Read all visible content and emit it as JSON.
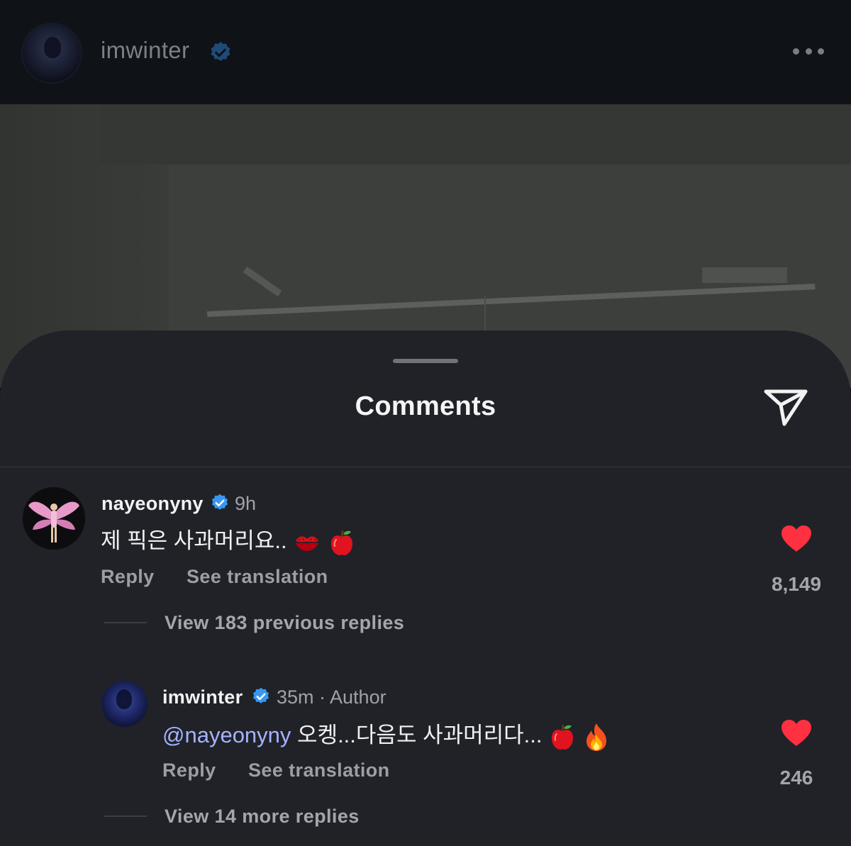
{
  "post": {
    "username": "imwinter"
  },
  "sheet": {
    "title": "Comments"
  },
  "comments": [
    {
      "username": "nayeonyny",
      "time": "9h",
      "text": "제 픽은 사과머리요..",
      "emojis": [
        "kiss-mark",
        "red-apple"
      ],
      "reply_label": "Reply",
      "translate_label": "See translation",
      "likes": "8,149",
      "view_replies": "View 183 previous replies"
    },
    {
      "username": "imwinter",
      "time": "35m · Author",
      "mention": "@nayeonyny",
      "text": " 오켕...다음도 사과머리다...",
      "emojis": [
        "red-apple",
        "fire"
      ],
      "reply_label": "Reply",
      "translate_label": "See translation",
      "likes": "246",
      "view_replies": "View 14 more replies"
    }
  ],
  "colors": {
    "sheet_bg": "#202228",
    "like_red": "#ff3040",
    "verified_blue": "#3897f0",
    "mention_blue": "#a5b3ff"
  },
  "icons": [
    "verified-badge-icon",
    "more-options-icon",
    "send-icon",
    "heart-icon"
  ]
}
